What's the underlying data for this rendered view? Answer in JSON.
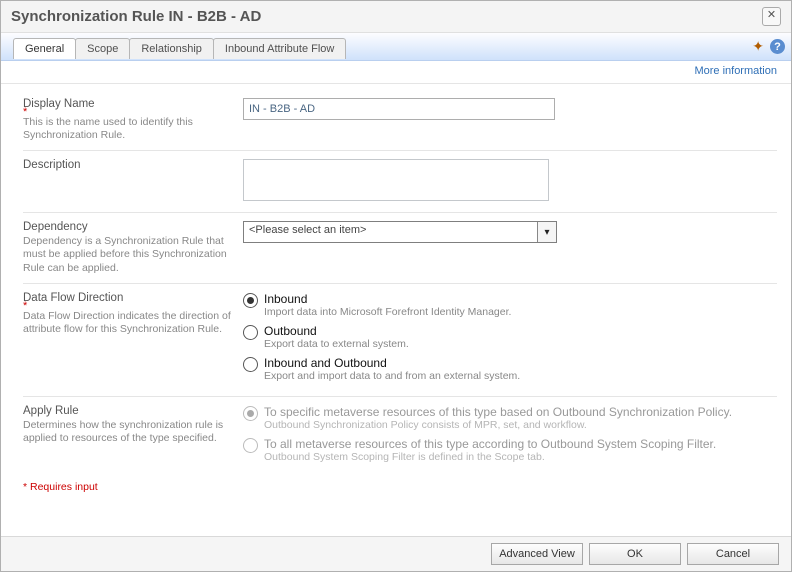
{
  "window": {
    "title": "Synchronization Rule IN - B2B - AD"
  },
  "tabs": [
    "General",
    "Scope",
    "Relationship",
    "Inbound Attribute Flow"
  ],
  "active_tab": 0,
  "info_link": "More information",
  "fields": {
    "display_name": {
      "label": "Display Name",
      "hint": "This is the name used to identify this Synchronization Rule.",
      "value": "IN - B2B - AD",
      "required": true
    },
    "description": {
      "label": "Description",
      "value": ""
    },
    "dependency": {
      "label": "Dependency",
      "hint": "Dependency is a Synchronization Rule that must be applied before this Synchronization Rule can be applied.",
      "placeholder": "<Please select an item>"
    },
    "flow": {
      "label": "Data Flow Direction",
      "hint": "Data Flow Direction indicates the direction of attribute flow for this Synchronization Rule.",
      "required": true,
      "options": [
        {
          "label": "Inbound",
          "desc": "Import data into Microsoft Forefront Identity Manager.",
          "selected": true
        },
        {
          "label": "Outbound",
          "desc": "Export data to external system.",
          "selected": false
        },
        {
          "label": "Inbound and Outbound",
          "desc": "Export and import data to and from an external system.",
          "selected": false
        }
      ]
    },
    "apply": {
      "label": "Apply Rule",
      "hint": "Determines how the synchronization rule is applied to resources of the type specified.",
      "options": [
        {
          "label": "To specific metaverse resources of this type based on Outbound Synchronization Policy.",
          "desc": "Outbound Synchronization Policy consists of MPR, set, and workflow.",
          "selected": true,
          "disabled": true
        },
        {
          "label": "To all metaverse resources of this type according to Outbound System Scoping Filter.",
          "desc": "Outbound System Scoping Filter is defined in the Scope tab.",
          "selected": false,
          "disabled": true
        }
      ]
    }
  },
  "requires_text": "* Requires input",
  "buttons": {
    "advanced": "Advanced View",
    "ok": "OK",
    "cancel": "Cancel"
  }
}
